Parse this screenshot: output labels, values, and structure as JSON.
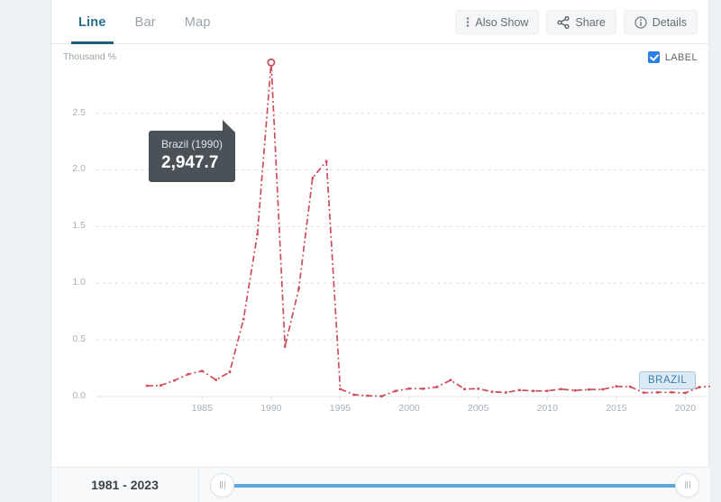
{
  "tabs": [
    {
      "label": "Line",
      "active": true
    },
    {
      "label": "Bar",
      "active": false
    },
    {
      "label": "Map",
      "active": false
    }
  ],
  "header_actions": [
    {
      "label": "Also Show",
      "icon": "kebab-icon"
    },
    {
      "label": "Share",
      "icon": "share-icon"
    },
    {
      "label": "Details",
      "icon": "info-icon"
    }
  ],
  "label_toggle": {
    "label": "LABEL",
    "checked": true
  },
  "series_badge": {
    "label": "BRAZIL"
  },
  "tooltip": {
    "title": "Brazil (1990)",
    "value": "2,947.7"
  },
  "range": {
    "label": "1981 - 2023",
    "start": 1981,
    "end": 2023
  },
  "colors": {
    "accent": "#2a7de1",
    "tab_active": "#1d5f7c",
    "series_line": "#cc4f5c",
    "badge_bg": "#dceaf5",
    "badge_text": "#3e7ea8",
    "tooltip_bg": "#4b5257",
    "slider_track": "#5fa8dc"
  },
  "chart_data": {
    "type": "line",
    "title": "",
    "xlabel": "",
    "ylabel": "Thousand %",
    "yunit": "Thousand %",
    "xlim": [
      1981,
      2023
    ],
    "ylim": [
      0.0,
      2.95
    ],
    "grid": true,
    "legend_position": "inline-right",
    "yticks": [
      "0.0",
      "0.5",
      "1.0",
      "1.5",
      "2.0",
      "2.5"
    ],
    "ytick_values": [
      0.0,
      0.5,
      1.0,
      1.5,
      2.0,
      2.5
    ],
    "xticks": [
      "1985",
      "1990",
      "1995",
      "2000",
      "2005",
      "2010",
      "2015",
      "2020"
    ],
    "xtick_values": [
      1985,
      1990,
      1995,
      2000,
      2005,
      2010,
      2015,
      2020
    ],
    "highlight": {
      "x": 1990,
      "y": 2.9477,
      "label": "Brazil (1990)",
      "value_label": "2,947.7"
    },
    "series": [
      {
        "name": "BRAZIL",
        "color": "#cc4f5c",
        "x": [
          1981,
          1982,
          1983,
          1984,
          1985,
          1986,
          1987,
          1988,
          1989,
          1990,
          1991,
          1992,
          1993,
          1994,
          1995,
          1996,
          1997,
          1998,
          1999,
          2000,
          2001,
          2002,
          2003,
          2004,
          2005,
          2006,
          2007,
          2008,
          2009,
          2010,
          2011,
          2012,
          2013,
          2014,
          2015,
          2016,
          2017,
          2018,
          2019,
          2020,
          2021,
          2022,
          2023
        ],
        "values": [
          0.095,
          0.098,
          0.142,
          0.197,
          0.226,
          0.147,
          0.216,
          0.683,
          1.431,
          2.948,
          0.441,
          0.951,
          1.928,
          2.076,
          0.066,
          0.016,
          0.007,
          0.003,
          0.049,
          0.07,
          0.069,
          0.084,
          0.145,
          0.066,
          0.069,
          0.042,
          0.036,
          0.057,
          0.049,
          0.05,
          0.066,
          0.054,
          0.062,
          0.063,
          0.09,
          0.087,
          0.034,
          0.037,
          0.037,
          0.032,
          0.083,
          0.092,
          0.046
        ]
      }
    ]
  }
}
